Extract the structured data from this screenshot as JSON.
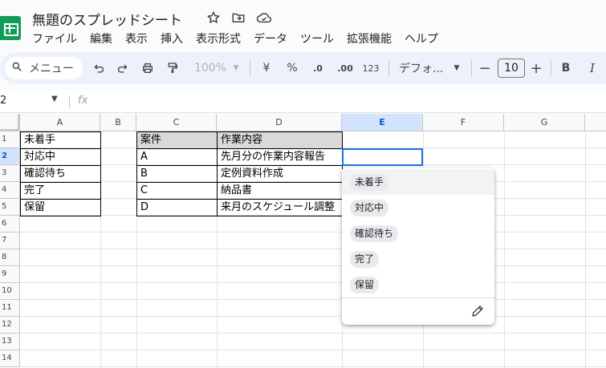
{
  "doc": {
    "title": "無題のスプレッドシート",
    "star_icon": "star-icon",
    "move_icon": "folder-move-icon",
    "cloud_icon": "cloud-status-icon"
  },
  "menu": [
    "ファイル",
    "編集",
    "表示",
    "挿入",
    "表示形式",
    "データ",
    "ツール",
    "拡張機能",
    "ヘルプ"
  ],
  "toolbar": {
    "search_label": "メニュー",
    "zoom": "100%",
    "currency": "¥",
    "percent": "%",
    "dec_decrease": ".0",
    "dec_increase": ".00",
    "number_format": "123",
    "font_name": "デフォ...",
    "font_size": "10",
    "bold": "B",
    "italic": "I"
  },
  "formula_bar": {
    "name_box": "2",
    "fx": "fx"
  },
  "columns": [
    "A",
    "B",
    "C",
    "D",
    "E",
    "F",
    "G"
  ],
  "selected_column": "E",
  "rows": [
    "1",
    "2",
    "3",
    "4",
    "5",
    "6",
    "7",
    "8",
    "9",
    "10",
    "11",
    "12",
    "13",
    "14"
  ],
  "selected_row": "2",
  "cells": {
    "A1": "未着手",
    "A2": "対応中",
    "A3": "確認待ち",
    "A4": "完了",
    "A5": "保留",
    "C1": "案件",
    "D1": "作業内容",
    "C2": "A",
    "C3": "B",
    "C4": "C",
    "C5": "D",
    "D2": "先月分の作業内容報告",
    "D3": "定例資料作成",
    "D4": "納品書",
    "D5": "来月のスケジュール調整"
  },
  "dropdown": {
    "options": [
      "未着手",
      "対応中",
      "確認待ち",
      "完了",
      "保留"
    ],
    "highlighted_option": "未着手",
    "edit_icon": "pencil-icon"
  },
  "colors": {
    "accent": "#1a73e8",
    "header_fill": "#d9d9d9",
    "selected_header": "#d3e3fd",
    "logo": "#0f9d58"
  }
}
